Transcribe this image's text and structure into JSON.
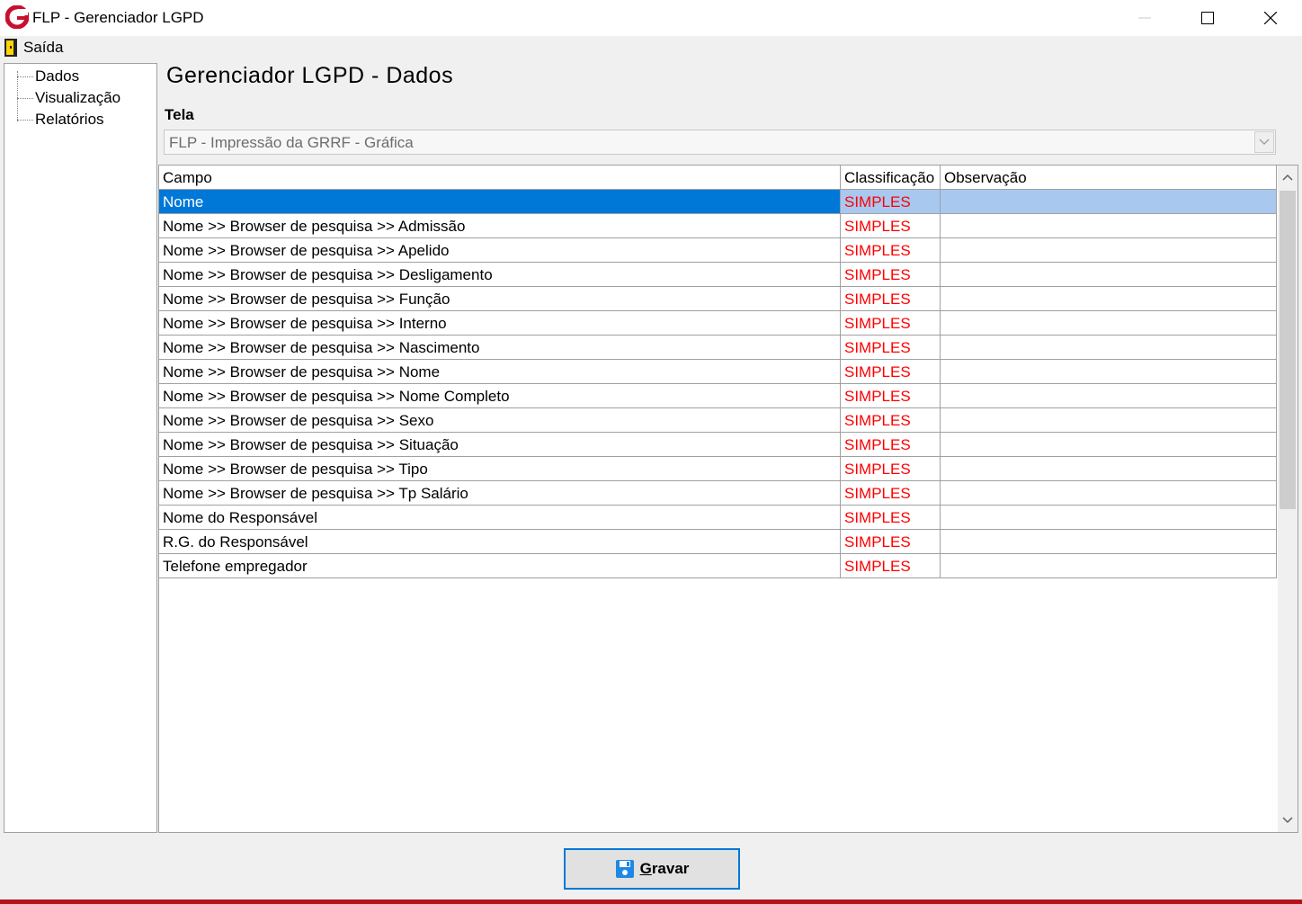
{
  "window": {
    "title": "FLP - Gerenciador LGPD",
    "logo_icon": "g-logo-icon",
    "controls": [
      "minimize",
      "maximize",
      "close"
    ]
  },
  "menu": {
    "exit_label": "Saída",
    "exit_icon": "door-exit-icon"
  },
  "tree": {
    "items": [
      {
        "label": "Dados"
      },
      {
        "label": "Visualização"
      },
      {
        "label": "Relatórios"
      }
    ]
  },
  "main": {
    "heading": "Gerenciador LGPD - Dados",
    "tela_label": "Tela",
    "tela_value": "FLP - Impressão da GRRF - Gráfica"
  },
  "grid": {
    "columns": [
      "Campo",
      "Classificação",
      "Observação"
    ],
    "selected_index": 0,
    "rows": [
      {
        "campo": "Nome",
        "classificacao": "SIMPLES",
        "observacao": ""
      },
      {
        "campo": "Nome >> Browser de pesquisa >> Admissão",
        "classificacao": "SIMPLES",
        "observacao": ""
      },
      {
        "campo": "Nome >> Browser de pesquisa >> Apelido",
        "classificacao": "SIMPLES",
        "observacao": ""
      },
      {
        "campo": "Nome >> Browser de pesquisa >> Desligamento",
        "classificacao": "SIMPLES",
        "observacao": ""
      },
      {
        "campo": "Nome >> Browser de pesquisa >> Função",
        "classificacao": "SIMPLES",
        "observacao": ""
      },
      {
        "campo": "Nome >> Browser de pesquisa >> Interno",
        "classificacao": "SIMPLES",
        "observacao": ""
      },
      {
        "campo": "Nome >> Browser de pesquisa >> Nascimento",
        "classificacao": "SIMPLES",
        "observacao": ""
      },
      {
        "campo": "Nome >> Browser de pesquisa >> Nome",
        "classificacao": "SIMPLES",
        "observacao": ""
      },
      {
        "campo": "Nome >> Browser de pesquisa >> Nome Completo",
        "classificacao": "SIMPLES",
        "observacao": ""
      },
      {
        "campo": "Nome >> Browser de pesquisa >> Sexo",
        "classificacao": "SIMPLES",
        "observacao": ""
      },
      {
        "campo": "Nome >> Browser de pesquisa >> Situação",
        "classificacao": "SIMPLES",
        "observacao": ""
      },
      {
        "campo": "Nome >> Browser de pesquisa >> Tipo",
        "classificacao": "SIMPLES",
        "observacao": ""
      },
      {
        "campo": "Nome >> Browser de pesquisa >> Tp Salário",
        "classificacao": "SIMPLES",
        "observacao": ""
      },
      {
        "campo": "Nome do Responsável",
        "classificacao": "SIMPLES",
        "observacao": ""
      },
      {
        "campo": "R.G. do Responsável",
        "classificacao": "SIMPLES",
        "observacao": ""
      },
      {
        "campo": "Telefone empregador",
        "classificacao": "SIMPLES",
        "observacao": ""
      }
    ]
  },
  "footer": {
    "save_label_first": "G",
    "save_label_rest": "ravar",
    "save_icon": "floppy-disk-icon"
  },
  "colors": {
    "selection": "#0078d7",
    "selection_light": "#a8c8ef",
    "classification_text": "#ff0000",
    "logo_red": "#c8102e"
  }
}
